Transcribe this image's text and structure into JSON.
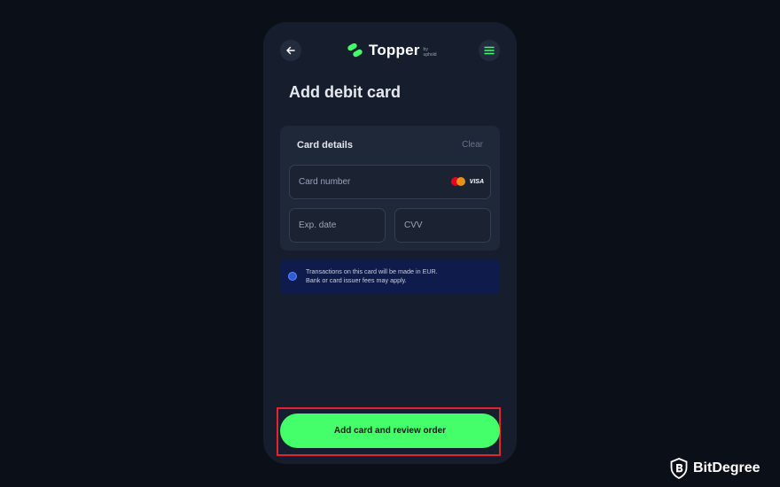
{
  "header": {
    "back_icon": "arrow-left-icon",
    "brand_name": "Topper",
    "brand_by": "by",
    "brand_sub": "uphold",
    "menu_icon": "hamburger-menu-icon",
    "accent_color": "#45ff6a"
  },
  "page": {
    "title": "Add debit card"
  },
  "card_details": {
    "label": "Card details",
    "clear_label": "Clear",
    "card_number_placeholder": "Card number",
    "brand_visa": "VISA",
    "expiry_placeholder": "Exp. date",
    "cvv_placeholder": "CVV"
  },
  "notice": {
    "line1": "Transactions on this card will be made in EUR.",
    "line2": "Bank or card issuer fees may apply."
  },
  "cta": {
    "label": "Add card and review order",
    "highlight_color": "#e0252b"
  },
  "watermark": {
    "text": "BitDegree"
  }
}
